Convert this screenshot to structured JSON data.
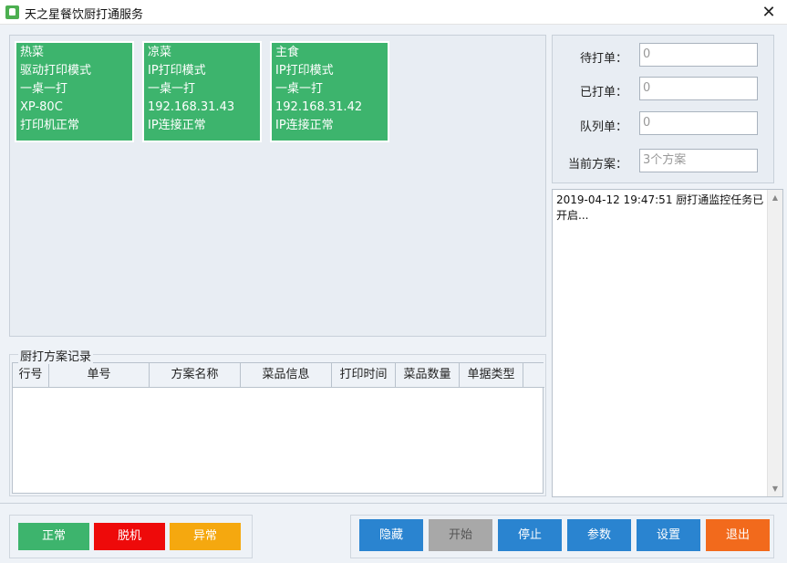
{
  "window": {
    "title": "天之星餐饮厨打通服务",
    "close_glyph": "✕"
  },
  "printers": [
    {
      "name": "热菜",
      "mode": "驱动打印模式",
      "policy": "一桌一打",
      "device": "XP-80C",
      "status": "打印机正常"
    },
    {
      "name": "凉菜",
      "mode": "IP打印模式",
      "policy": "一桌一打",
      "device": "192.168.31.43",
      "status": "IP连接正常"
    },
    {
      "name": "主食",
      "mode": "IP打印模式",
      "policy": "一桌一打",
      "device": "192.168.31.42",
      "status": "IP连接正常"
    }
  ],
  "log_group": {
    "title": "厨打方案记录",
    "columns": [
      "行号",
      "单号",
      "方案名称",
      "菜品信息",
      "打印时间",
      "菜品数量",
      "单据类型"
    ]
  },
  "stats": {
    "pending_label": "待打单：",
    "pending_value": "0",
    "printed_label": "已打单：",
    "printed_value": "0",
    "queue_label": "队列单：",
    "queue_value": "0",
    "scheme_label": "当前方案：",
    "scheme_value": "3个方案"
  },
  "log_box": {
    "text": "2019-04-12 19:47:51 厨打通监控任务已开启..."
  },
  "legend": {
    "normal": "正常",
    "offline": "脱机",
    "error": "异常"
  },
  "buttons": {
    "hide": "隐藏",
    "start": "开始",
    "stop": "停止",
    "params": "参数",
    "settings": "设置",
    "exit": "退出"
  },
  "colors": {
    "card_green": "#3db46d",
    "normal": "#3db46d",
    "offline": "#ee0a0a",
    "error": "#f5a80f",
    "btn_blue": "#2a84d0",
    "btn_disabled": "#a8a8a8",
    "btn_exit": "#f26a1c"
  }
}
